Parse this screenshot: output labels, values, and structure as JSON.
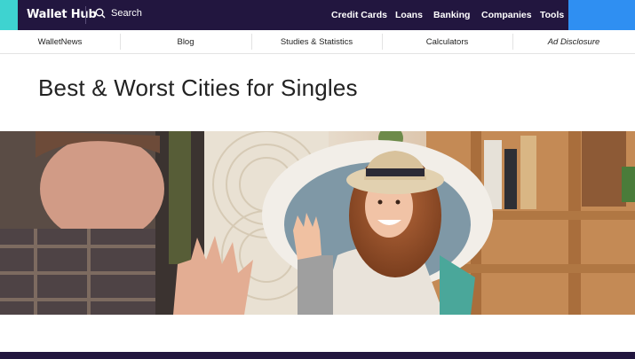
{
  "header": {
    "logo": "Wallet Hub",
    "search_label": "Search",
    "nav": [
      "Credit Cards",
      "Loans",
      "Banking",
      "Companies",
      "Tools"
    ]
  },
  "subnav": [
    "WalletNews",
    "Blog",
    "Studies & Statistics",
    "Calculators",
    "Ad Disclosure"
  ],
  "article": {
    "title": "Best & Worst Cities for Singles"
  },
  "colors": {
    "header_bg": "#22163f",
    "accent_cyan": "#3ed3d0",
    "accent_blue": "#2f8ff2"
  },
  "icons": [
    "search-icon"
  ]
}
